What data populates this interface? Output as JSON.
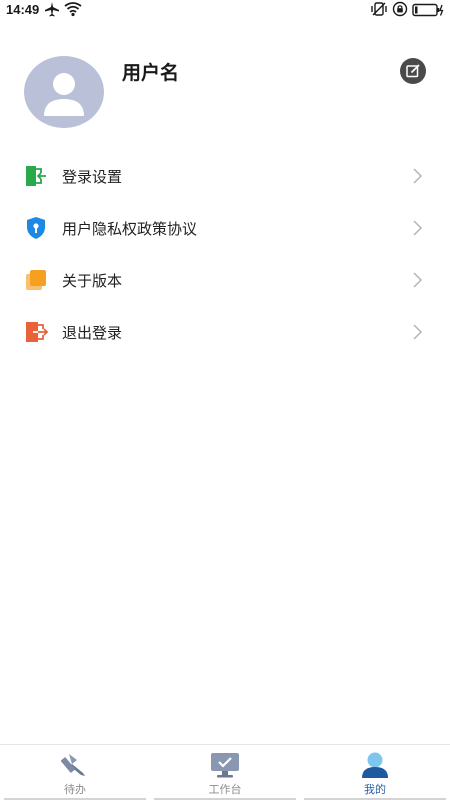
{
  "status_bar": {
    "time": "14:49"
  },
  "profile": {
    "username": "用户名"
  },
  "menu": {
    "items": [
      {
        "label": "登录设置",
        "icon": "login-settings-icon",
        "color": "#2aa84a"
      },
      {
        "label": "用户隐私权政策协议",
        "icon": "shield-icon",
        "color": "#1e88e5"
      },
      {
        "label": "关于版本",
        "icon": "version-icon",
        "color": "#f5a020"
      },
      {
        "label": "退出登录",
        "icon": "logout-icon",
        "color": "#e8633a"
      }
    ]
  },
  "tabs": {
    "items": [
      {
        "label": "待办",
        "icon": "todo-icon",
        "active": false
      },
      {
        "label": "工作台",
        "icon": "workbench-icon",
        "active": false
      },
      {
        "label": "我的",
        "icon": "profile-icon",
        "active": true
      }
    ]
  },
  "colors": {
    "accent": "#2b5fa8",
    "avatar_bg": "#b9c0d8",
    "chevron": "#b5b5b5",
    "tab_inactive": "#8c8c8c"
  }
}
